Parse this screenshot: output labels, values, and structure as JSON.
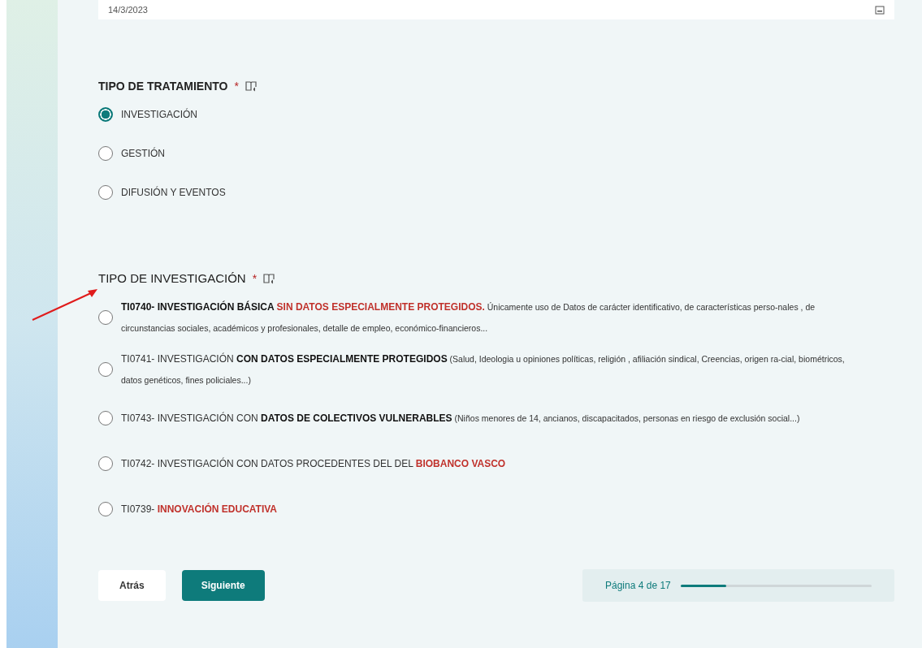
{
  "date_field": {
    "value": "14/3/2023"
  },
  "questions": [
    {
      "title": "TIPO DE TRATAMIENTO",
      "title_bold": true,
      "required_mark": "*",
      "options": [
        {
          "segments": [
            {
              "text": "INVESTIGACIÓN",
              "kind": "plain"
            }
          ],
          "selected": true
        },
        {
          "segments": [
            {
              "text": "GESTIÓN",
              "kind": "plain"
            }
          ],
          "selected": false
        },
        {
          "segments": [
            {
              "text": "DIFUSIÓN Y EVENTOS",
              "kind": "plain"
            }
          ],
          "selected": false
        }
      ]
    },
    {
      "title": "TIPO DE INVESTIGACIÓN",
      "title_bold": false,
      "required_mark": "*",
      "options": [
        {
          "segments": [
            {
              "text": "TI0740- INVESTIGACIÓN BÁSICA ",
              "kind": "bold"
            },
            {
              "text": "SIN DATOS ESPECIALMENTE PROTEGIDOS.",
              "kind": "red"
            },
            {
              "text": " Únicamente uso de Datos de carácter identificativo, de características perso-nales ,  de circunstancias sociales,  académicos y profesionales, detalle de empleo, económico-financieros...",
              "kind": "small"
            }
          ],
          "selected": false
        },
        {
          "segments": [
            {
              "text": "TI0741- INVESTIGACIÓN ",
              "kind": "plain"
            },
            {
              "text": "CON DATOS ESPECIALMENTE PROTEGIDOS",
              "kind": "bold"
            },
            {
              "text": " (Salud, Ideologia u opiniones políticas, religión , afiliación sindical, Creencias, origen ra-cial, biométricos, datos genéticos, fines policiales...)",
              "kind": "small"
            }
          ],
          "selected": false
        },
        {
          "segments": [
            {
              "text": "TI0743- INVESTIGACIÓN CON ",
              "kind": "plain"
            },
            {
              "text": "DATOS DE COLECTIVOS VULNERABLES",
              "kind": "bold"
            },
            {
              "text": " (Niños menores de 14, ancianos, discapacitados, personas en riesgo de exclusión social...)",
              "kind": "small"
            }
          ],
          "selected": false
        },
        {
          "segments": [
            {
              "text": "TI0742- INVESTIGACIÓN CON DATOS PROCEDENTES DEL DEL ",
              "kind": "plain"
            },
            {
              "text": "BIOBANCO VASCO",
              "kind": "red"
            }
          ],
          "selected": false
        },
        {
          "segments": [
            {
              "text": "TI0739- ",
              "kind": "plain"
            },
            {
              "text": "INNOVACIÓN EDUCATIVA",
              "kind": "red"
            }
          ],
          "selected": false
        }
      ]
    }
  ],
  "buttons": [
    {
      "label": "Atrás",
      "kind": "secondary"
    },
    {
      "label": "Siguiente",
      "kind": "primary"
    }
  ],
  "progress": {
    "label": "Página 4 de 17",
    "level": 0.24
  }
}
